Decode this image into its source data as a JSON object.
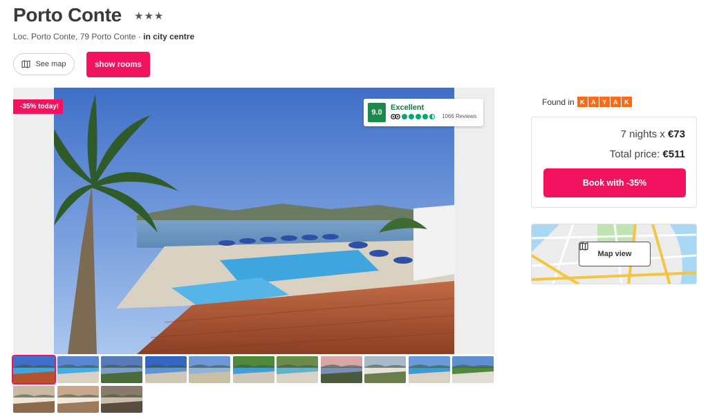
{
  "hotel": {
    "name": "Porto Conte",
    "stars": "★★★",
    "address": "Loc. Porto Conte, 79 Porto Conte · ",
    "location_tag": "in city centre"
  },
  "actions": {
    "see_map": "See map",
    "show_rooms": "show rooms"
  },
  "gallery": {
    "discount_badge": "-35% today!",
    "rating": {
      "score": "9.0",
      "label": "Excellent",
      "reviews": "1066 Reviews",
      "bubbles": 4.5
    },
    "thumbnail_count": 14,
    "selected_thumbnail": 1
  },
  "booking": {
    "found_in_label": "Found in",
    "provider_letters": [
      "K",
      "A",
      "Y",
      "A",
      "K"
    ],
    "nights_text": "7 nights x ",
    "nightly_price": "€73",
    "total_label": "Total price: ",
    "total_price": "€511",
    "book_button": "Book with -35%"
  },
  "map": {
    "button_label": "Map view"
  },
  "colors": {
    "accent": "#f3125f",
    "rating_green": "#1b8a4b",
    "kayak_orange": "#ff690f"
  }
}
